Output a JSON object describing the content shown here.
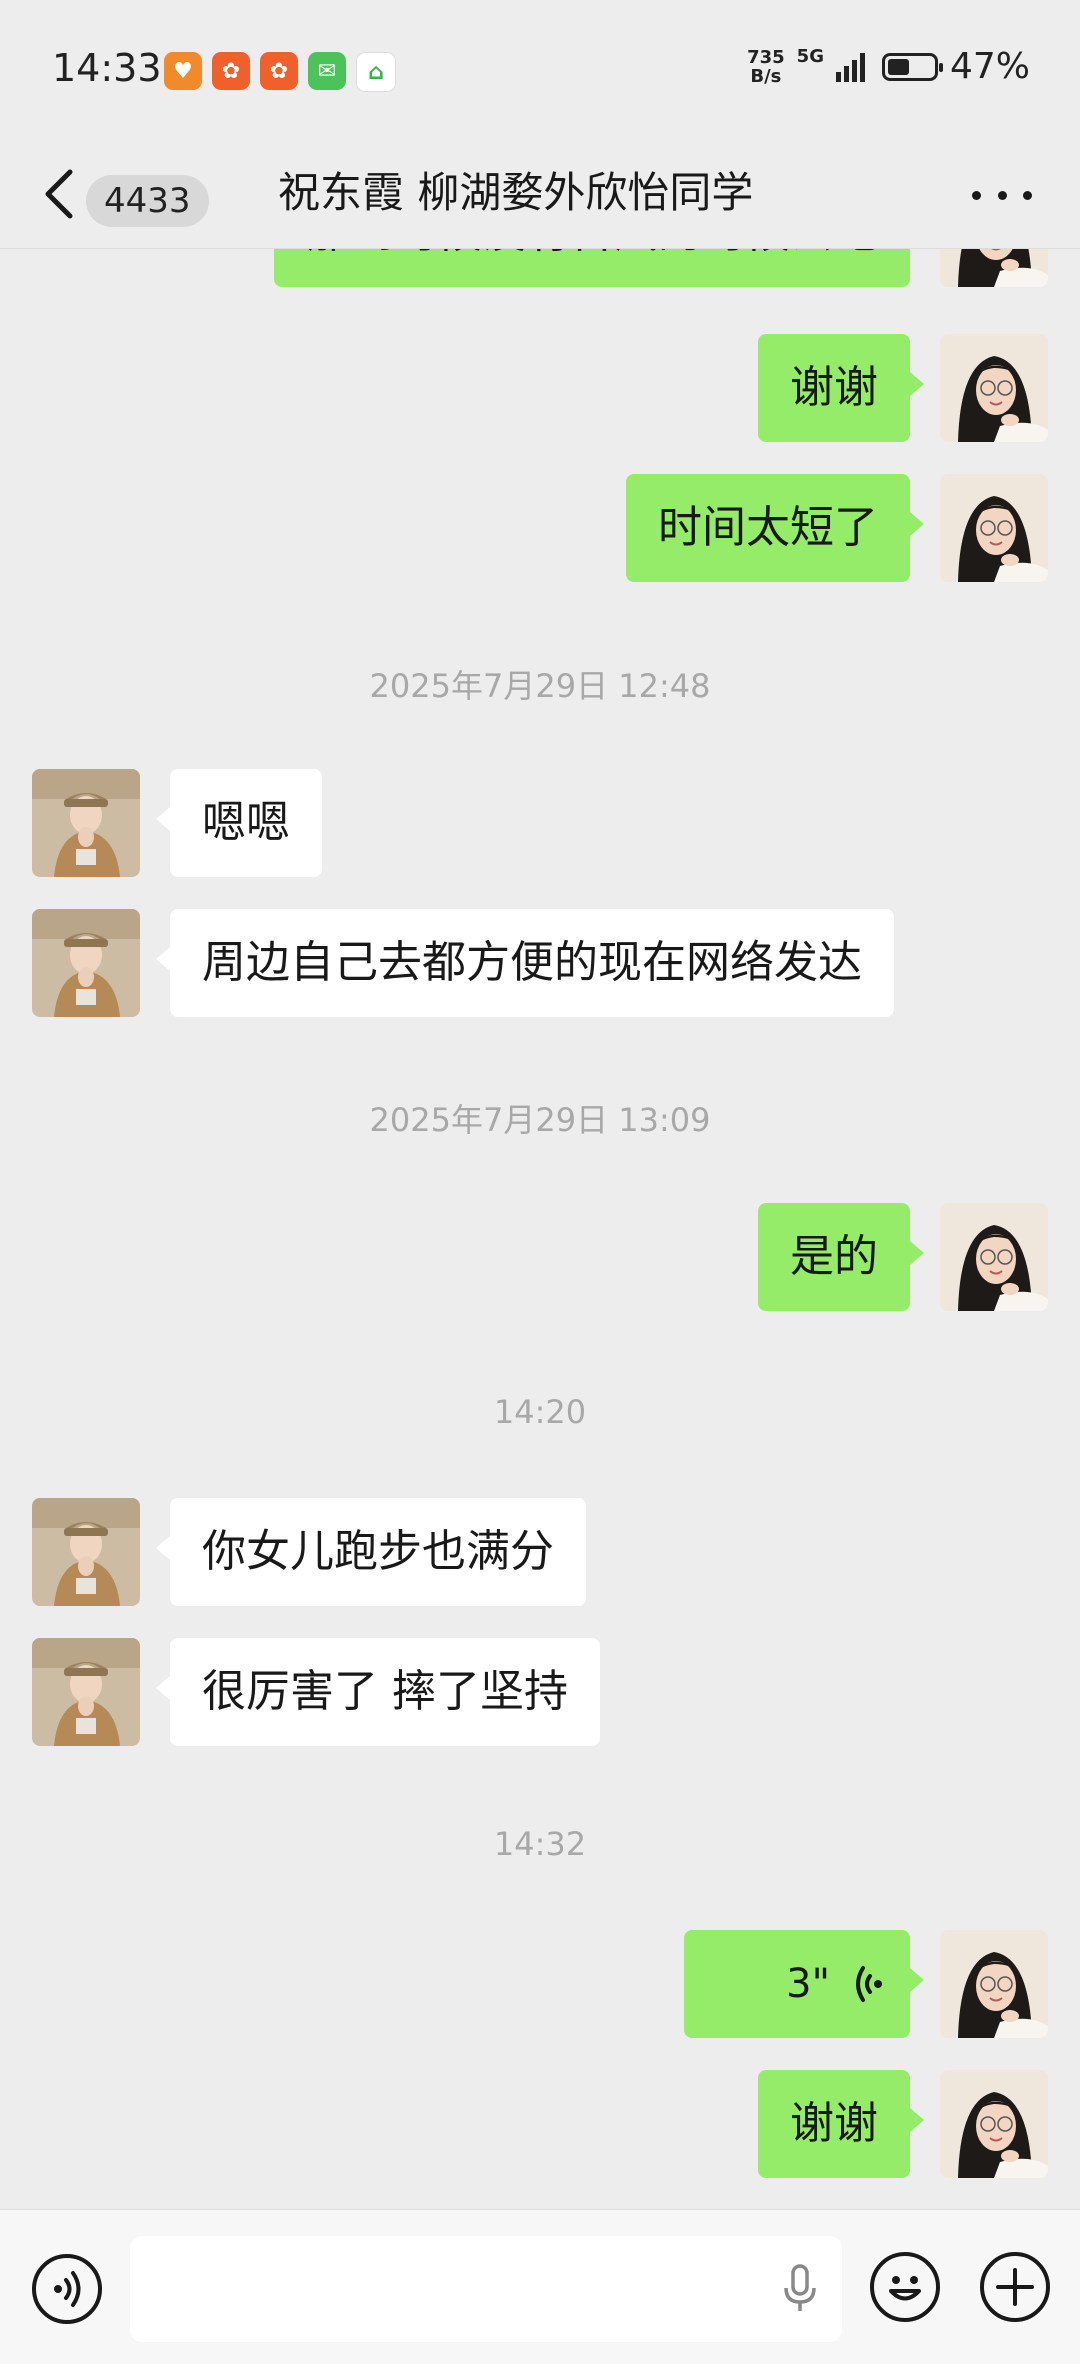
{
  "status_bar": {
    "time": "14:33",
    "net_speed_value": "735",
    "net_speed_unit": "B/s",
    "network": "5G",
    "battery_percent": "47%",
    "battery_level": 0.47,
    "app_icons": [
      "heart-app-icon",
      "kuaishou-icon",
      "kuaishou-icon",
      "wechat-icon",
      "home-app-icon"
    ]
  },
  "header": {
    "unread_count": "4433",
    "title": "祝东霞 柳湖婺外欣怡同学"
  },
  "messages": [
    {
      "side": "me",
      "text": "那到时候没有台风的时候去吧"
    },
    {
      "side": "me",
      "text": "谢谢"
    },
    {
      "side": "me",
      "text": "时间太短了"
    },
    {
      "type": "time",
      "text": "2025年7月29日 12:48"
    },
    {
      "side": "them",
      "text": "嗯嗯"
    },
    {
      "side": "them",
      "text": "周边自己去都方便的现在网络发达"
    },
    {
      "type": "time",
      "text": "2025年7月29日 13:09"
    },
    {
      "side": "me",
      "text": "是的"
    },
    {
      "type": "time",
      "text": "14:20"
    },
    {
      "side": "them",
      "text": "你女儿跑步也满分"
    },
    {
      "side": "them",
      "text": "很厉害了 摔了坚持"
    },
    {
      "type": "time",
      "text": "14:32"
    },
    {
      "side": "me",
      "type": "voice",
      "text": "3\""
    },
    {
      "side": "me",
      "text": "谢谢"
    }
  ],
  "colors": {
    "background": "#ededed",
    "me_bubble": "#95ec69",
    "them_bubble": "#ffffff",
    "timestamp": "#a8a8a8"
  }
}
